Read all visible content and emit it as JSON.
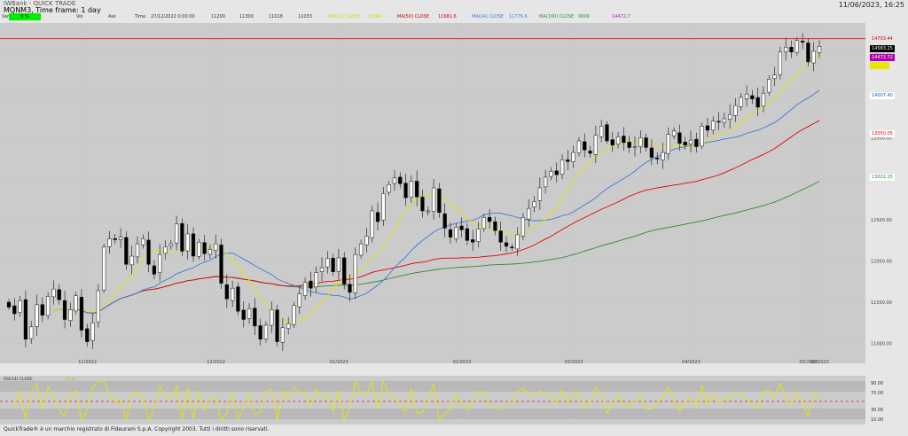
{
  "header": {
    "app_name": "IWBank - QUICK TRADE",
    "title": "MQNM3, Time frame: 1 day",
    "datetime": "11/06/2023, 16:25"
  },
  "info_bar": {
    "change_label": "Var.%",
    "change_value": "0 %",
    "vol_label": "Vol",
    "ask_label": "Ask",
    "time_label": "Time",
    "time_value": "27/12/2022 0:00:00",
    "open": "11200",
    "high": "11300",
    "low": "11018",
    "close": "11033",
    "indicators": [
      {
        "label": "MA(12) CLOSE",
        "value": "13984",
        "color": "#e6e600"
      },
      {
        "label": "MA(50) CLOSE",
        "value": "11681.6",
        "color": "#e60000"
      },
      {
        "label": "MA(24) CLOSE",
        "value": "11776.6",
        "color": "#3a7bd5"
      },
      {
        "label": "MA(100) CLOSE",
        "value": "9999",
        "color": "#2e8b2e"
      },
      {
        "label": "",
        "value": "14472.7",
        "color": "#a020c0"
      }
    ]
  },
  "price_tags": [
    {
      "text": "14703.44",
      "bg": "none",
      "fg": "#cc0000",
      "y": 14703
    },
    {
      "text": "14583.25",
      "bg": "#000000",
      "fg": "#ffffff",
      "y": 14583
    },
    {
      "text": "14472.72",
      "bg": "#b000b0",
      "fg": "#ffffff",
      "y": 14473
    },
    {
      "text": "",
      "bg": "#e6e600",
      "fg": "#000000",
      "y": 14380
    },
    {
      "text": "14007.40",
      "bg": "#ffffff",
      "fg": "#1560d0",
      "y": 14007
    },
    {
      "text": "13550.05",
      "bg": "#ffffff",
      "fg": "#dd0000",
      "y": 13550
    },
    {
      "text": "13022.15",
      "bg": "#ffffff",
      "fg": "#1e8c1e",
      "y": 13022
    }
  ],
  "oscillator": {
    "label": "RSI(14) CLOSE",
    "value": "51.6",
    "levels": [
      "90.00",
      "70.00",
      "30.00",
      "10.00"
    ]
  },
  "footer": {
    "text": "QuickTrade® è un marchio registrato di Fideuram S.p.A. Copyright 2003. Tutti i diritti sono riservati."
  },
  "chart_data": {
    "type": "candlestick",
    "x_labels": [
      "11/2022",
      "12/2022",
      "01/2023",
      "02/2023",
      "03/2023",
      "04/2023",
      "05/2023",
      "06/2023"
    ],
    "y_labels": [
      "14500.00",
      "14000.00",
      "13500.00",
      "13000.00",
      "12500.00",
      "12000.00",
      "11500.00",
      "11000.00"
    ],
    "ylim": [
      10800,
      14850
    ],
    "resistance_level": 14703.44,
    "colors": {
      "up_candle": "#ffffff",
      "down_candle": "#000000",
      "ma_fast": "#e6e600",
      "ma_mid": "#3a7bd5",
      "ma_slow": "#e60000",
      "ma_long": "#2e8b2e",
      "resistance": "#e02020"
    },
    "close": [
      11440,
      11360,
      11520,
      11050,
      11200,
      11470,
      11340,
      11570,
      11660,
      11530,
      11290,
      11410,
      11580,
      11160,
      11020,
      11250,
      11640,
      12170,
      12270,
      12260,
      12290,
      11960,
      12060,
      12210,
      12270,
      11960,
      11840,
      12080,
      12170,
      12210,
      12450,
      12120,
      12330,
      12060,
      12230,
      12090,
      12140,
      12210,
      11730,
      11540,
      11670,
      11390,
      11290,
      11420,
      11210,
      11050,
      11220,
      11410,
      11020,
      11190,
      11240,
      11460,
      11600,
      11740,
      11670,
      11860,
      11920,
      12030,
      11870,
      12040,
      11720,
      11620,
      12080,
      12210,
      12300,
      12610,
      12480,
      12820,
      12930,
      13010,
      12940,
      12770,
      12970,
      12780,
      12610,
      12610,
      12890,
      12590,
      12400,
      12290,
      12410,
      12380,
      12250,
      12230,
      12390,
      12530,
      12480,
      12370,
      12230,
      12180,
      12160,
      12320,
      12530,
      12640,
      12720,
      12890,
      13020,
      13090,
      13050,
      13230,
      13210,
      13320,
      13460,
      13350,
      13310,
      13530,
      13640,
      13460,
      13410,
      13510,
      13440,
      13380,
      13390,
      13500,
      13380,
      13260,
      13240,
      13320,
      13540,
      13580,
      13430,
      13410,
      13470,
      13390,
      13640,
      13590,
      13700,
      13690,
      13730,
      13780,
      13890,
      13990,
      14030,
      13970,
      13870,
      14040,
      14210,
      14260,
      14540,
      14600,
      14540,
      14680,
      14660,
      14420,
      14550,
      14610
    ]
  }
}
